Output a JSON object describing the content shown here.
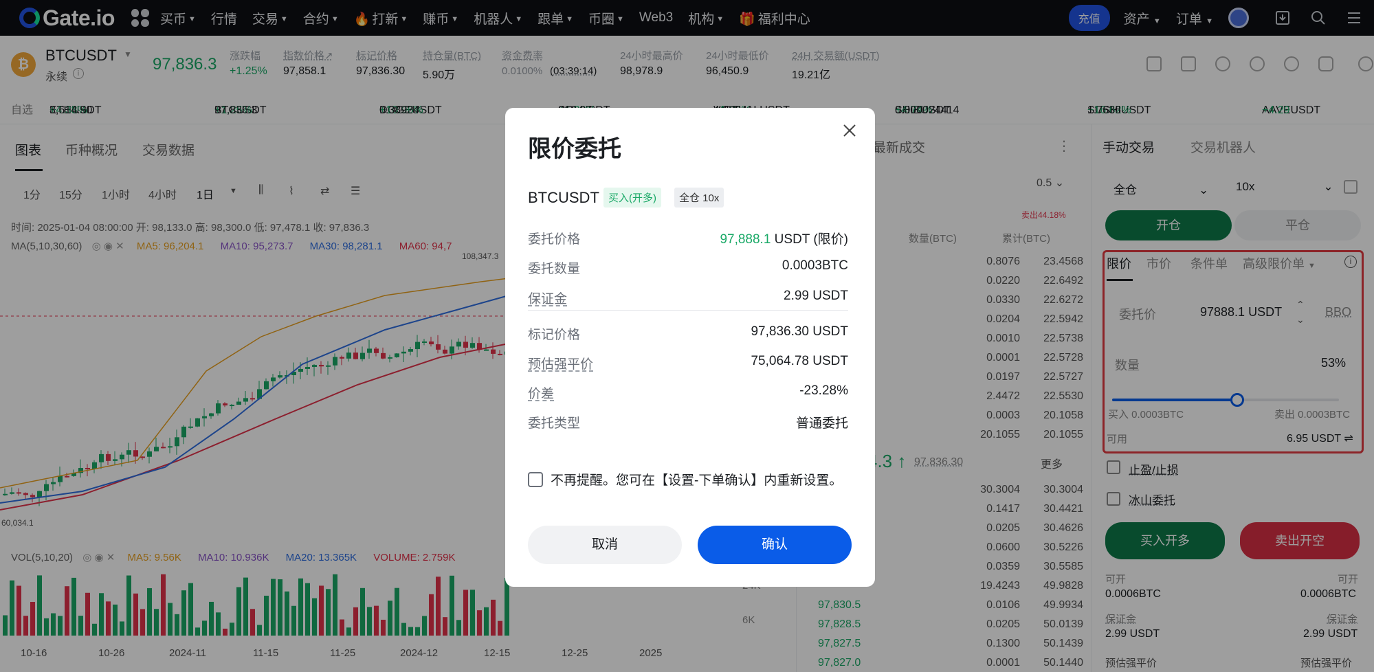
{
  "nav": {
    "logo": "Gate.io",
    "items": [
      "买币",
      "行情",
      "交易",
      "合约",
      "打新",
      "赚币",
      "机器人",
      "跟单",
      "币圈",
      "Web3",
      "机构",
      "福利中心"
    ],
    "deposit": "充值",
    "assets": "资产",
    "orders": "订单"
  },
  "ticker": {
    "symbol": "BTCUSDT",
    "type": "永续",
    "price": "97,836.3",
    "change_label": "涨跌幅",
    "change_value": "+1.25%",
    "index_label": "指数价格↗",
    "index_value": "97,858.1",
    "mark_label": "标记价格",
    "mark_value": "97,836.30",
    "oi_label": "持仓量(BTC)",
    "oi_value": "5.90万",
    "funding_label": "资金费率",
    "funding_value": "0.0100%",
    "funding_timer": "(03:39:14)",
    "high_label": "24小时最高价",
    "high_value": "98,978.9",
    "low_label": "24小时最低价",
    "low_value": "96,450.9",
    "vol_label": "24H 交易额(USDT)",
    "vol_value": "19.21亿"
  },
  "watchlist": {
    "label": "自选",
    "items": [
      {
        "sym": "ETHUSDT",
        "chg": "+4.38%",
        "price": "3,614.90"
      },
      {
        "sym": "BTCUSDT",
        "chg": "+1.25%",
        "price": "97,836.3"
      },
      {
        "sym": "DOGEUSDT",
        "chg": "+10.96%",
        "price": "0.38924"
      },
      {
        "sym": "SOLUSDT",
        "chg": "+1.38%",
        "price": "216.27"
      },
      {
        "sym": "VIRTUALUSDT",
        "chg": "+1.86%",
        "price": "4.2864"
      },
      {
        "sym": "SHIBUSDT",
        "chg": "+4.74%",
        "price": "0.000024414"
      },
      {
        "sym": "SUSHIUSDT",
        "chg": "+16.62%",
        "price": "1.7636"
      },
      {
        "sym": "AAVEUSDT",
        "chg": "+4.29",
        "price": ""
      }
    ]
  },
  "chart": {
    "tabs": [
      "图表",
      "币种概况",
      "交易数据"
    ],
    "intervals": [
      "1分",
      "15分",
      "1小时",
      "4小时",
      "1日"
    ],
    "ohlc": "时间: 2025-01-04 08:00:00  开: 98,133.0  高: 98,300.0  低: 97,478.1  收: 97,836.3",
    "ma_label": "MA(5,10,30,60)",
    "ma5": "MA5: 96,204.1",
    "ma10": "MA10: 95,273.7",
    "ma30": "MA30: 98,281.1",
    "ma60": "MA60: 94,7",
    "high_mark": "108,347.3",
    "low_mark": "60,034.1",
    "vol_label": "VOL(5,10,20)",
    "vma5": "MA5: 9.56K",
    "vma10": "MA10: 10.936K",
    "vma20": "MA20: 13.365K",
    "volume": "VOLUME: 2.759K",
    "vol_axis_24": "24K",
    "vol_axis_6": "6K",
    "x_labels": [
      "10-16",
      "10-26",
      "2024-11",
      "11-15",
      "11-25",
      "2024-12",
      "12-15",
      "12-25",
      "2025"
    ]
  },
  "orderbook": {
    "tab": "最新成交",
    "depth": "0.5",
    "ratio": "卖出44.18%",
    "col_qty": "数量(BTC)",
    "col_total": "累计(BTC)",
    "asks": [
      {
        "q": "0.8076",
        "t": "23.4568"
      },
      {
        "q": "0.0220",
        "t": "22.6492"
      },
      {
        "q": "0.0330",
        "t": "22.6272"
      },
      {
        "q": "0.0204",
        "t": "22.5942"
      },
      {
        "q": "0.0010",
        "t": "22.5738"
      },
      {
        "q": "0.0001",
        "t": "22.5728"
      },
      {
        "q": "0.0197",
        "t": "22.5727"
      },
      {
        "q": "2.4472",
        "t": "22.5530"
      },
      {
        "q": "0.0003",
        "t": "20.1058"
      },
      {
        "q": "20.1055",
        "t": "20.1055"
      }
    ],
    "mid_price": "4.3 ↑",
    "mid_mark": "97,836.30",
    "more": "更多",
    "bids": [
      {
        "p": "",
        "q": "30.3004",
        "t": "30.3004"
      },
      {
        "p": "",
        "q": "0.1417",
        "t": "30.4421"
      },
      {
        "p": "",
        "q": "0.0205",
        "t": "30.4626"
      },
      {
        "p": "",
        "q": "0.0600",
        "t": "30.5226"
      },
      {
        "p": "",
        "q": "0.0359",
        "t": "30.5585"
      },
      {
        "p": "",
        "q": "19.4243",
        "t": "49.9828"
      },
      {
        "p": "97,830.5",
        "q": "0.0106",
        "t": "49.9934"
      },
      {
        "p": "97,828.5",
        "q": "0.0205",
        "t": "50.0139"
      },
      {
        "p": "97,827.5",
        "q": "0.1300",
        "t": "50.1439"
      },
      {
        "p": "97,827.0",
        "q": "0.0001",
        "t": "50.1440"
      }
    ]
  },
  "panel": {
    "tab_manual": "手动交易",
    "tab_bot": "交易机器人",
    "margin_mode": "全仓",
    "leverage": "10x",
    "open": "开仓",
    "close": "平仓",
    "order_types": [
      "限价",
      "市价",
      "条件单",
      "高级限价单"
    ],
    "price_label": "委托价",
    "price_value": "97888.1 USDT",
    "bbo": "BBO",
    "qty_label": "数量",
    "qty_pct": "53%",
    "buy_qty": "买入  0.0003BTC",
    "sell_qty": "卖出  0.0003BTC",
    "avail_label": "可用",
    "avail_value": "6.95 USDT",
    "tpsl": "止盈/止损",
    "iceberg": "冰山委托",
    "buy_btn": "买入开多",
    "sell_btn": "卖出开空",
    "can_open": "可开",
    "can_open_l": "0.0006BTC",
    "can_open_r": "0.0006BTC",
    "margin": "保证金",
    "margin_l": "2.99 USDT",
    "margin_r": "2.99 USDT",
    "liq": "预估强平价"
  },
  "dialog": {
    "title": "限价委托",
    "symbol": "BTCUSDT",
    "tag_side": "买入(开多)",
    "tag_mode": "全仓 10x",
    "rows": [
      {
        "k": "委托价格",
        "v_num": "97,888.1",
        "v_unit": " USDT (限价)"
      },
      {
        "k": "委托数量",
        "v": "0.0003BTC"
      },
      {
        "k": "保证金",
        "v": "2.99 USDT"
      },
      {
        "k": "标记价格",
        "v": "97,836.30 USDT"
      },
      {
        "k": "预估强平价",
        "v": "75,064.78 USDT"
      },
      {
        "k": "价差",
        "v": "-23.28%"
      },
      {
        "k": "委托类型",
        "v": "普通委托"
      }
    ],
    "checkbox_text": "不再提醒。您可在【设置-下单确认】内重新设置。",
    "cancel": "取消",
    "confirm": "确认"
  },
  "colors": {
    "accent": "#0a5ce8",
    "up": "#1aa967",
    "down": "#e2334b",
    "highlight": "#e23b42"
  }
}
